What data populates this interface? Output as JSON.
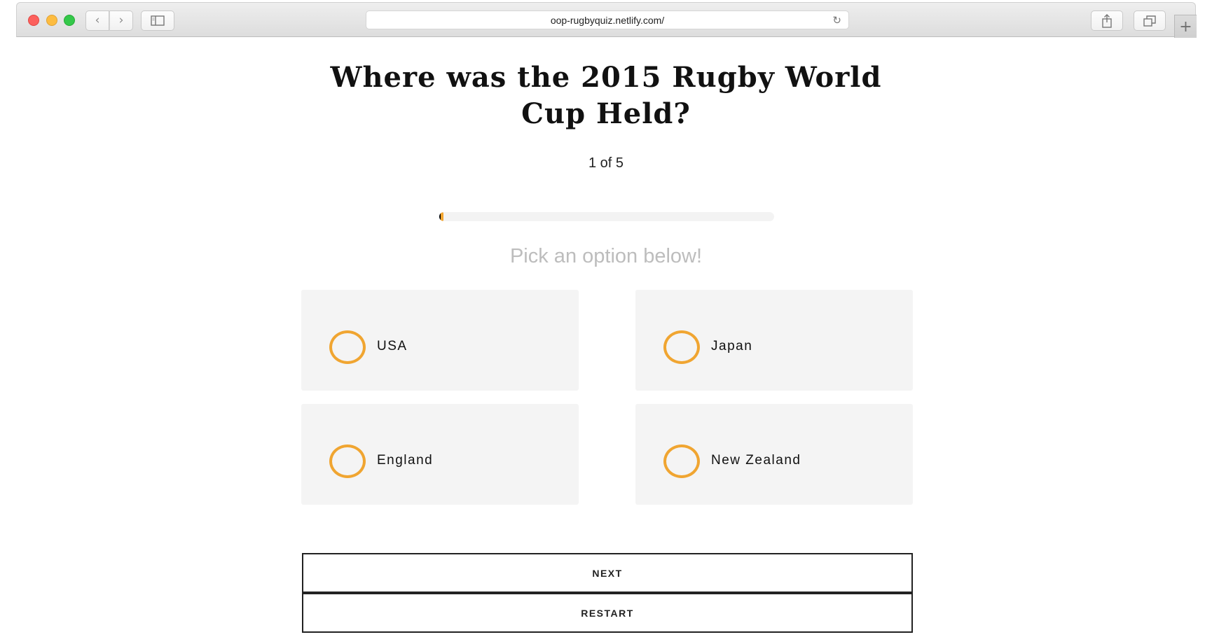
{
  "browser": {
    "url": "oop-rugbyquiz.netlify.com/",
    "icons": {
      "back": "chevron-left-icon",
      "forward": "chevron-right-icon",
      "sidebar": "sidebar-icon",
      "reload": "reload-icon",
      "share": "share-icon",
      "tabs": "tabs-icon",
      "new_tab": "plus-icon"
    }
  },
  "quiz": {
    "question": "Where was the 2015 Rugby World Cup Held?",
    "counter": "1 of 5",
    "progress_fraction": 0.01,
    "prompt": "Pick an option below!",
    "options": [
      {
        "label": "USA"
      },
      {
        "label": "Japan"
      },
      {
        "label": "England"
      },
      {
        "label": "New Zealand"
      }
    ],
    "next_label": "NEXT",
    "restart_label": "RESTART"
  },
  "colors": {
    "accent": "#f0a531",
    "card_bg": "#f4f4f4",
    "prompt_text": "#bdbdbd"
  }
}
